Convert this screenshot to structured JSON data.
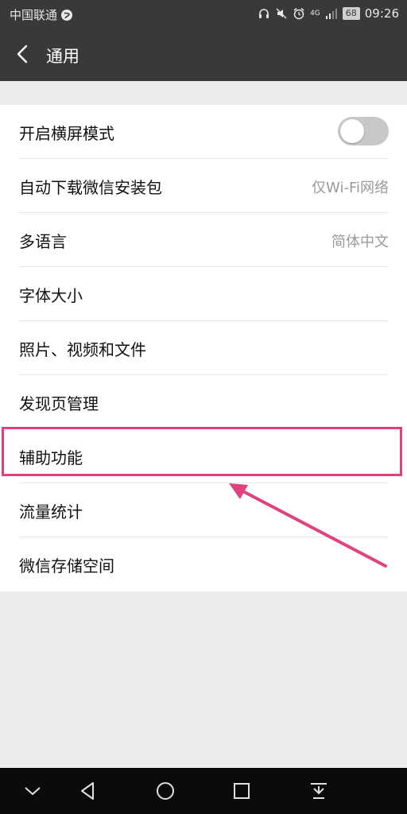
{
  "status_bar": {
    "carrier": "中国联通",
    "network": "4G",
    "battery": "68",
    "time": "09:26"
  },
  "nav": {
    "title": "通用"
  },
  "settings": [
    {
      "label": "开启横屏模式",
      "toggle_on": false
    },
    {
      "label": "自动下载微信安装包",
      "value": "仅Wi-Fi网络"
    },
    {
      "label": "多语言",
      "value": "简体中文"
    },
    {
      "label": "字体大小"
    },
    {
      "label": "照片、视频和文件"
    },
    {
      "label": "发现页管理"
    },
    {
      "label": "辅助功能",
      "highlighted": true
    },
    {
      "label": "流量统计"
    },
    {
      "label": "微信存储空间"
    }
  ],
  "colors": {
    "bar": "#393939",
    "highlight": "#e0427f",
    "background": "#ebebeb"
  }
}
